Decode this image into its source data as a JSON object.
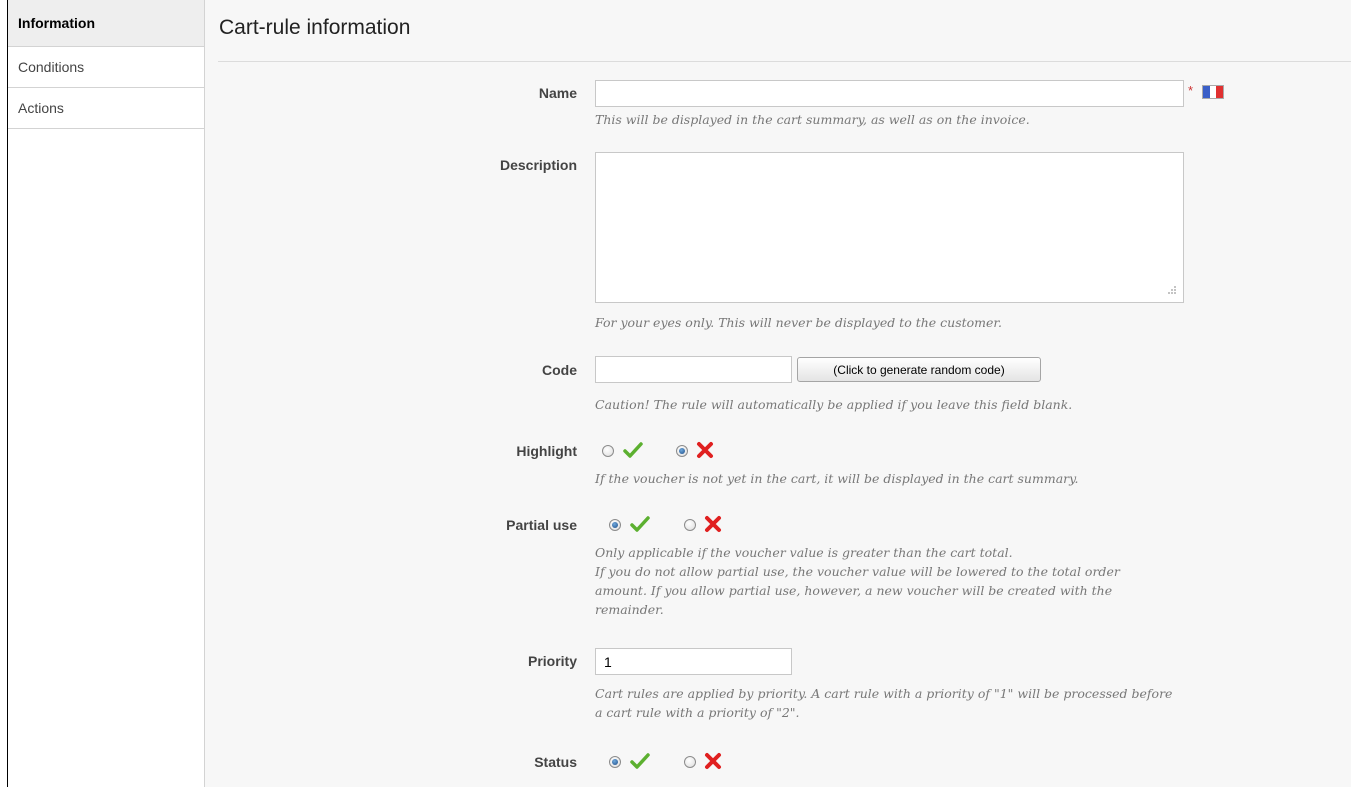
{
  "sidebar": {
    "items": [
      {
        "label": "Information",
        "active": true
      },
      {
        "label": "Conditions",
        "active": false
      },
      {
        "label": "Actions",
        "active": false
      }
    ]
  },
  "page_title": "Cart-rule information",
  "form": {
    "name": {
      "label": "Name",
      "value": "",
      "required_marker": "*",
      "language_flag": "fr-flag-icon",
      "hint": "This will be displayed in the cart summary, as well as on the invoice."
    },
    "description": {
      "label": "Description",
      "value": "",
      "hint": "For your eyes only. This will never be displayed to the customer."
    },
    "code": {
      "label": "Code",
      "value": "",
      "generate_button": "(Click to generate random code)",
      "hint": "Caution! The rule will automatically be applied if you leave this field blank."
    },
    "highlight": {
      "label": "Highlight",
      "selected": "no",
      "hint": "If the voucher is not yet in the cart, it will be displayed in the cart summary."
    },
    "partial_use": {
      "label": "Partial use",
      "selected": "yes",
      "hint_lines": [
        "Only applicable if the voucher value is greater than the cart total.",
        "If you do not allow partial use, the voucher value will be lowered to the total order",
        "amount. If you allow partial use, however, a new voucher will be created with the",
        "remainder."
      ]
    },
    "priority": {
      "label": "Priority",
      "value": "1",
      "hint_lines": [
        "Cart rules are applied by priority. A cart rule with a priority of \"1\" will be processed before",
        "a cart rule with a priority of \"2\"."
      ]
    },
    "status": {
      "label": "Status",
      "selected": "yes"
    }
  },
  "colors": {
    "check": "#5cb030",
    "cross": "#e02020",
    "flag_blue": "#3a5fc8",
    "flag_white": "#ffffff",
    "flag_red": "#e03030"
  }
}
